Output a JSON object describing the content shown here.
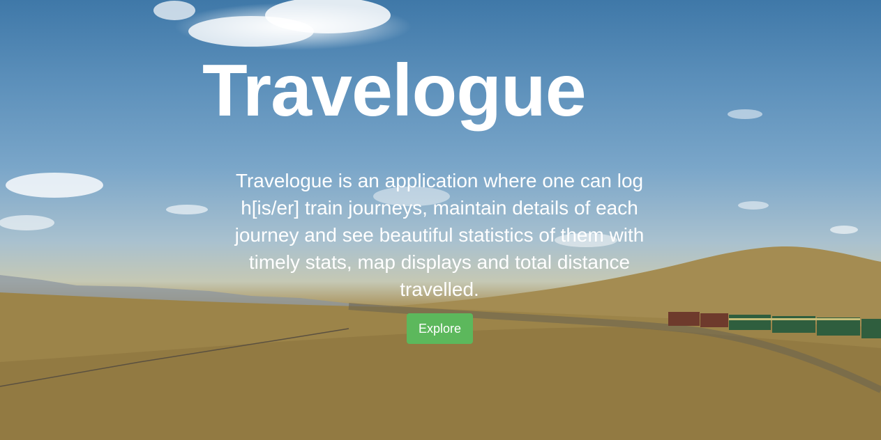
{
  "hero": {
    "title": "Travelogue",
    "description": "Travelogue is an application where one can log h[is/er] train journeys, maintain details of each journey and see beautiful statistics of them with timely stats, map displays and total distance travelled.",
    "explore_label": "Explore"
  },
  "colors": {
    "button": "#5cb85c",
    "text": "#ffffff"
  }
}
